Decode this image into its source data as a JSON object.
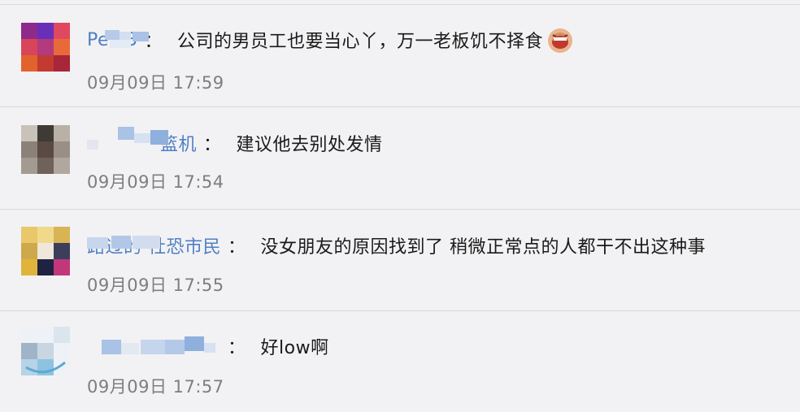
{
  "comments": [
    {
      "username": "Pe  x3",
      "text": "公司的男员工也要当心丫，万一老板饥不择食",
      "emoji": "laughing-face-emoji",
      "time": "09月09日 17:59"
    },
    {
      "username": "篮机",
      "text": "建议他去别处发情",
      "time": "09月09日 17:54"
    },
    {
      "username": "路过的  社恐市民",
      "text": "没女朋友的原因找到了 稍微正常点的人都干不出这种事",
      "time": "09月09日 17:55"
    },
    {
      "username": "",
      "text": "好low啊",
      "time": "09月09日 17:57"
    }
  ],
  "colors": {
    "background": "#f2f2f4",
    "username": "#4f7fc4",
    "timestamp": "#7d7d82",
    "divider": "#d9d9dd"
  }
}
